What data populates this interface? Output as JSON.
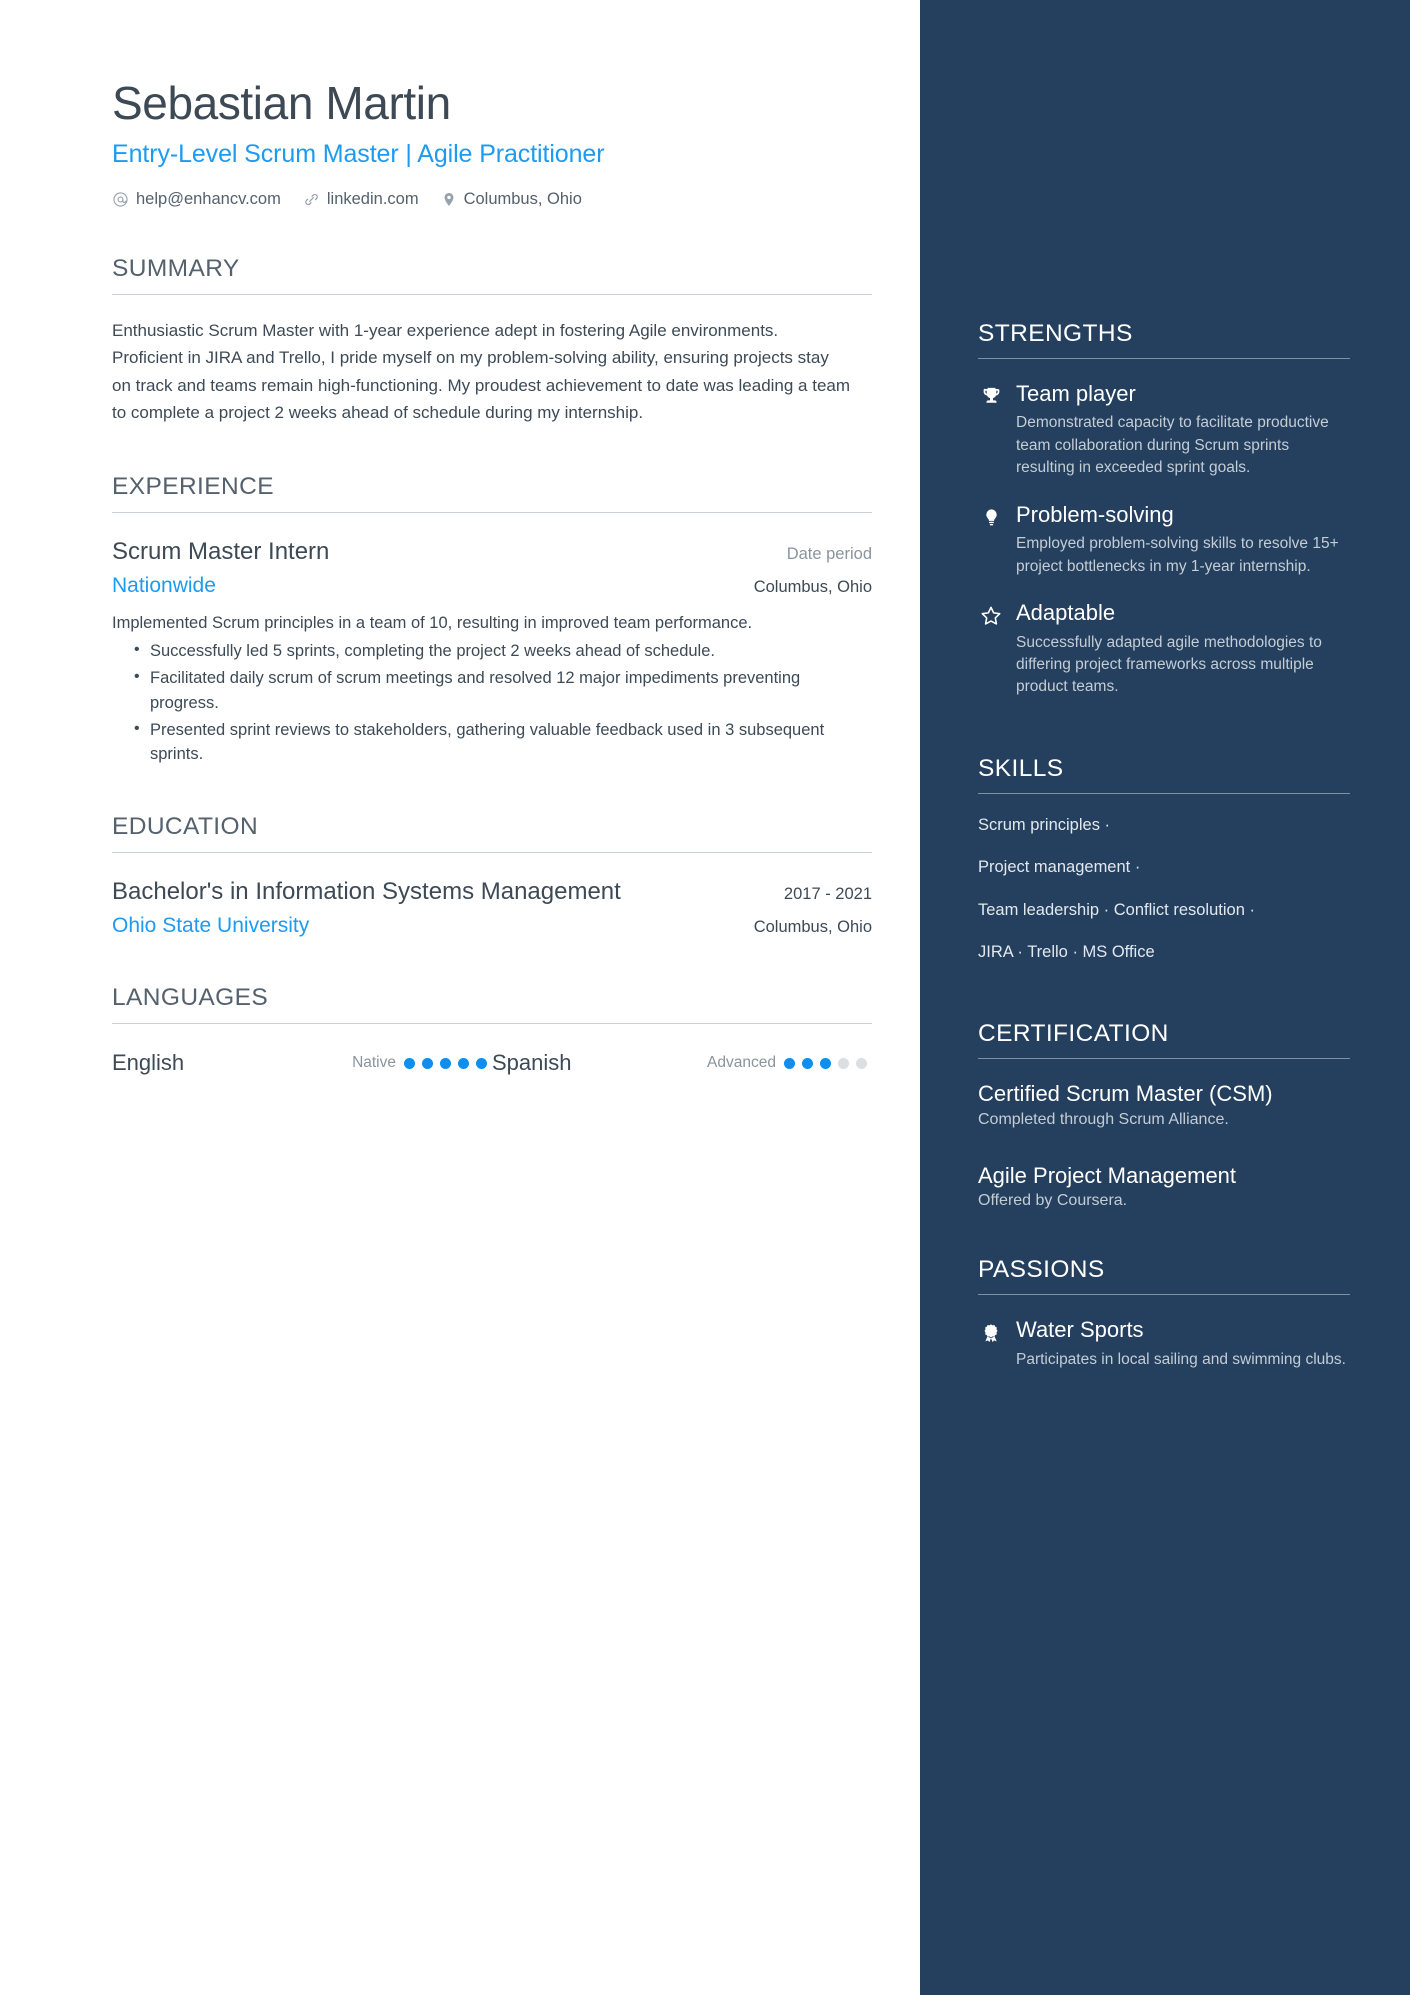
{
  "header": {
    "name": "Sebastian Martin",
    "headline": "Entry-Level Scrum Master | Agile Practitioner",
    "contacts": [
      {
        "icon": "at-icon",
        "text": "help@enhancv.com"
      },
      {
        "icon": "link-icon",
        "text": "linkedin.com"
      },
      {
        "icon": "location-pin-icon",
        "text": "Columbus, Ohio"
      }
    ]
  },
  "summary": {
    "title": "SUMMARY",
    "text": "Enthusiastic Scrum Master with 1-year experience adept in fostering Agile environments. Proficient in JIRA and Trello, I pride myself on my problem-solving ability, ensuring projects stay on track and teams remain high-functioning. My proudest achievement to date was leading a team to complete a project 2 weeks ahead of schedule during my internship."
  },
  "experience": {
    "title": "EXPERIENCE",
    "entries": [
      {
        "role": "Scrum Master Intern",
        "date": "Date period",
        "company": "Nationwide",
        "location": "Columbus, Ohio",
        "description": "Implemented Scrum principles in a team of 10, resulting in improved team performance.",
        "bullets": [
          "Successfully led 5 sprints, completing the project 2 weeks ahead of schedule.",
          "Facilitated daily scrum of scrum meetings and resolved 12 major impediments preventing progress.",
          "Presented sprint reviews to stakeholders, gathering valuable feedback used in 3 subsequent sprints."
        ]
      }
    ]
  },
  "education": {
    "title": "EDUCATION",
    "entries": [
      {
        "degree": "Bachelor's in Information Systems Management",
        "date": "2017 - 2021",
        "school": "Ohio State University",
        "location": "Columbus, Ohio"
      }
    ]
  },
  "languages": {
    "title": "LANGUAGES",
    "items": [
      {
        "name": "English",
        "level": "Native",
        "filled": 5,
        "total": 5
      },
      {
        "name": "Spanish",
        "level": "Advanced",
        "filled": 3,
        "total": 5
      }
    ]
  },
  "strengths": {
    "title": "STRENGTHS",
    "items": [
      {
        "icon": "trophy-icon",
        "name": "Team player",
        "description": "Demonstrated capacity to facilitate productive team collaboration during Scrum sprints resulting in exceeded sprint goals."
      },
      {
        "icon": "lightbulb-icon",
        "name": "Problem-solving",
        "description": "Employed problem-solving skills to resolve 15+ project bottlenecks in my 1-year internship."
      },
      {
        "icon": "star-icon",
        "name": "Adaptable",
        "description": "Successfully adapted agile methodologies to differing project frameworks across multiple product teams."
      }
    ]
  },
  "skills": {
    "title": "SKILLS",
    "lines": [
      "Scrum principles ·",
      "Project management ·",
      "Team leadership · Conflict resolution ·",
      "JIRA · Trello · MS Office"
    ]
  },
  "certification": {
    "title": "CERTIFICATION",
    "items": [
      {
        "name": "Certified Scrum Master (CSM)",
        "description": "Completed through Scrum Alliance."
      },
      {
        "name": "Agile Project Management",
        "description": "Offered by Coursera."
      }
    ]
  },
  "passions": {
    "title": "PASSIONS",
    "items": [
      {
        "icon": "award-ribbon-icon",
        "name": "Water Sports",
        "description": "Participates in local sailing and swimming clubs."
      }
    ]
  },
  "colors": {
    "sidebar_bg": "#24405e",
    "accent_blue": "#1c9bf0",
    "dot_on": "#0d8ef0",
    "dot_off": "#dcdfe2",
    "text_dark": "#3d4a56",
    "text_muted": "#8a949e"
  }
}
